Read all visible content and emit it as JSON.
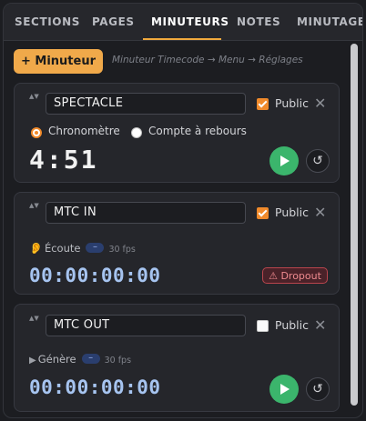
{
  "tabs": [
    {
      "label": "SECTIONS"
    },
    {
      "label": "PAGES"
    },
    {
      "label": "MINUTEURS"
    },
    {
      "label": "NOTES"
    },
    {
      "label": "MINUTAGE"
    }
  ],
  "active_tab": "MINUTEURS",
  "toolbar": {
    "add_icon": "+",
    "add_label": "Minuteur",
    "hint": "Minuteur Timecode → Menu → Réglages"
  },
  "timers": [
    {
      "name": "SPECTACLE",
      "public_label": "Public",
      "public_checked": true,
      "mode_options": [
        "Chronomètre",
        "Compte à rebours"
      ],
      "mode_selected": "Chronomètre",
      "time": "4:51"
    },
    {
      "name": "MTC IN",
      "public_label": "Public",
      "public_checked": true,
      "status": "Écoute",
      "status_icon": "ear-icon",
      "badge": "–",
      "fps": "30 fps",
      "timecode": "00:00:00:00",
      "alert_icon": "⚠",
      "alert": "Dropout"
    },
    {
      "name": "MTC OUT",
      "public_label": "Public",
      "public_checked": false,
      "status": "Génère",
      "status_icon": "play-small-icon",
      "badge": "–",
      "fps": "30 fps",
      "timecode": "00:00:00:00"
    }
  ],
  "icons": {
    "close": "✕",
    "reset": "↺",
    "drag": "▲▼"
  },
  "colors": {
    "accent": "#f0a94a",
    "checkbox": "#f08a2b",
    "play": "#3bb56c",
    "timecode": "#a6c4f0",
    "alert": "#ee8a8f",
    "background": "#1c1d21",
    "card": "#25262b"
  }
}
